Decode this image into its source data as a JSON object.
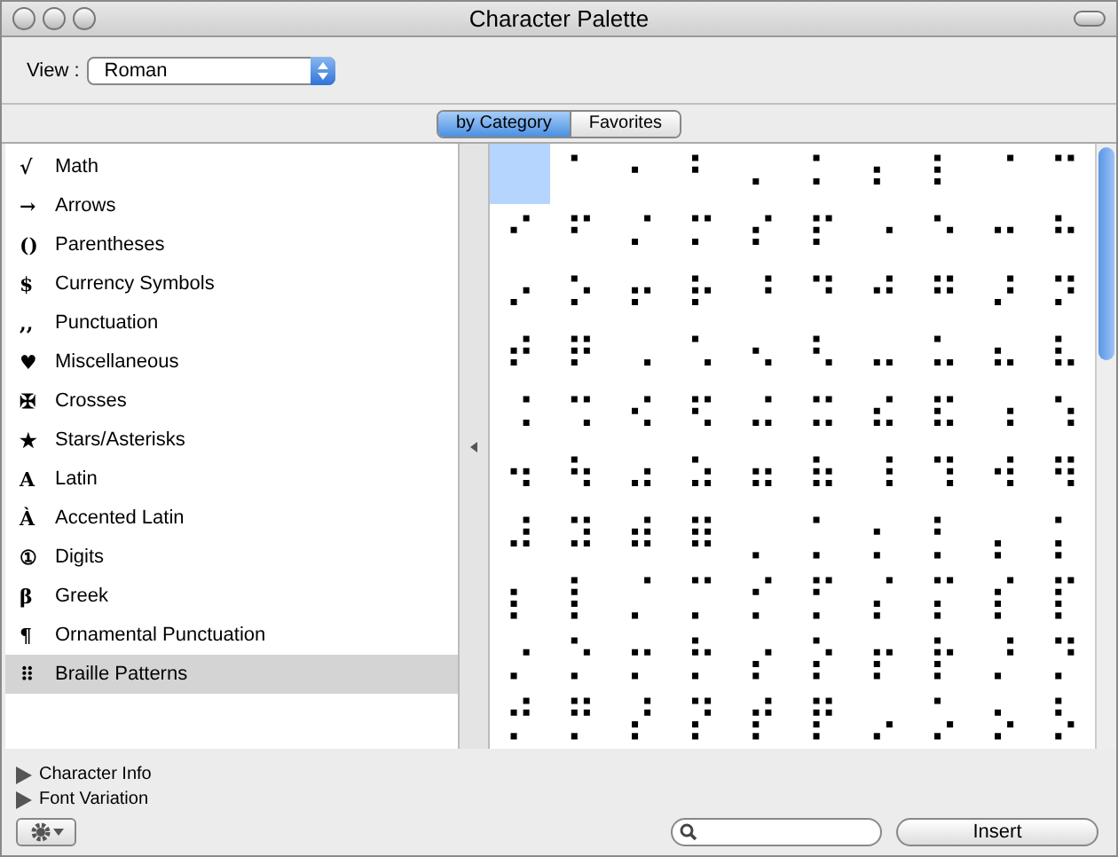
{
  "window": {
    "title": "Character Palette"
  },
  "view": {
    "label": "View :",
    "value": "Roman"
  },
  "tabs": [
    {
      "label": "by Category",
      "selected": true
    },
    {
      "label": "Favorites",
      "selected": false
    }
  ],
  "sidebar": {
    "items": [
      {
        "icon": "√",
        "label": "Math",
        "selected": false
      },
      {
        "icon": "→",
        "label": "Arrows",
        "selected": false
      },
      {
        "icon": "()",
        "label": "Parentheses",
        "selected": false
      },
      {
        "icon": "$",
        "label": "Currency Symbols",
        "selected": false
      },
      {
        "icon": ",,",
        "label": "Punctuation",
        "selected": false
      },
      {
        "icon": "♥",
        "label": "Miscellaneous",
        "selected": false
      },
      {
        "icon": "✠",
        "label": "Crosses",
        "selected": false
      },
      {
        "icon": "★",
        "label": "Stars/Asterisks",
        "selected": false
      },
      {
        "icon": "A",
        "label": "Latin",
        "selected": false
      },
      {
        "icon": "À",
        "label": "Accented Latin",
        "selected": false
      },
      {
        "icon": "①",
        "label": "Digits",
        "selected": false
      },
      {
        "icon": "β",
        "label": "Greek",
        "selected": false
      },
      {
        "icon": "¶",
        "label": "Ornamental Punctuation",
        "selected": false
      },
      {
        "icon": "⠿",
        "label": "Braille Patterns",
        "selected": true
      }
    ]
  },
  "grid": {
    "cells": [
      {
        "selected": true
      },
      {
        "char": "⠁",
        "selected": false
      },
      {
        "char": "⠂",
        "selected": false
      },
      {
        "char": "⠃",
        "selected": false
      },
      {
        "char": "⠄",
        "selected": false
      },
      {
        "char": "⠅",
        "selected": false
      },
      {
        "char": "⠆",
        "selected": false
      },
      {
        "char": "⠇",
        "selected": false
      },
      {
        "char": "⠈",
        "selected": false
      },
      {
        "char": "⠉",
        "selected": false
      },
      {
        "char": "⠊",
        "selected": false
      },
      {
        "char": "⠋",
        "selected": false
      },
      {
        "char": "⠌",
        "selected": false
      },
      {
        "char": "⠍",
        "selected": false
      },
      {
        "char": "⠎",
        "selected": false
      },
      {
        "char": "⠏",
        "selected": false
      },
      {
        "char": "⠐",
        "selected": false
      },
      {
        "char": "⠑",
        "selected": false
      },
      {
        "char": "⠒",
        "selected": false
      },
      {
        "char": "⠓",
        "selected": false
      },
      {
        "char": "⠔",
        "selected": false
      },
      {
        "char": "⠕",
        "selected": false
      },
      {
        "char": "⠖",
        "selected": false
      },
      {
        "char": "⠗",
        "selected": false
      },
      {
        "char": "⠘",
        "selected": false
      },
      {
        "char": "⠙",
        "selected": false
      },
      {
        "char": "⠚",
        "selected": false
      },
      {
        "char": "⠛",
        "selected": false
      },
      {
        "char": "⠜",
        "selected": false
      },
      {
        "char": "⠝",
        "selected": false
      },
      {
        "char": "⠞",
        "selected": false
      },
      {
        "char": "⠟",
        "selected": false
      },
      {
        "char": "⠠",
        "selected": false
      },
      {
        "char": "⠡",
        "selected": false
      },
      {
        "char": "⠢",
        "selected": false
      },
      {
        "char": "⠣",
        "selected": false
      },
      {
        "char": "⠤",
        "selected": false
      },
      {
        "char": "⠥",
        "selected": false
      },
      {
        "char": "⠦",
        "selected": false
      },
      {
        "char": "⠧",
        "selected": false
      },
      {
        "char": "⠨",
        "selected": false
      },
      {
        "char": "⠩",
        "selected": false
      },
      {
        "char": "⠪",
        "selected": false
      },
      {
        "char": "⠫",
        "selected": false
      },
      {
        "char": "⠬",
        "selected": false
      },
      {
        "char": "⠭",
        "selected": false
      },
      {
        "char": "⠮",
        "selected": false
      },
      {
        "char": "⠯",
        "selected": false
      },
      {
        "char": "⠰",
        "selected": false
      },
      {
        "char": "⠱",
        "selected": false
      },
      {
        "char": "⠲",
        "selected": false
      },
      {
        "char": "⠳",
        "selected": false
      },
      {
        "char": "⠴",
        "selected": false
      },
      {
        "char": "⠵",
        "selected": false
      },
      {
        "char": "⠶",
        "selected": false
      },
      {
        "char": "⠷",
        "selected": false
      },
      {
        "char": "⠸",
        "selected": false
      },
      {
        "char": "⠹",
        "selected": false
      },
      {
        "char": "⠺",
        "selected": false
      },
      {
        "char": "⠻",
        "selected": false
      },
      {
        "char": "⠼",
        "selected": false
      },
      {
        "char": "⠽",
        "selected": false
      },
      {
        "char": "⠾",
        "selected": false
      },
      {
        "char": "⠿",
        "selected": false
      },
      {
        "char": "⡀",
        "selected": false
      },
      {
        "char": "⡁",
        "selected": false
      },
      {
        "char": "⡂",
        "selected": false
      },
      {
        "char": "⡃",
        "selected": false
      },
      {
        "char": "⡄",
        "selected": false
      },
      {
        "char": "⡅",
        "selected": false
      },
      {
        "char": "⡆",
        "selected": false
      },
      {
        "char": "⡇",
        "selected": false
      },
      {
        "char": "⡈",
        "selected": false
      },
      {
        "char": "⡉",
        "selected": false
      },
      {
        "char": "⡊",
        "selected": false
      },
      {
        "char": "⡋",
        "selected": false
      },
      {
        "char": "⡌",
        "selected": false
      },
      {
        "char": "⡍",
        "selected": false
      },
      {
        "char": "⡎",
        "selected": false
      },
      {
        "char": "⡏",
        "selected": false
      },
      {
        "char": "⡐",
        "selected": false
      },
      {
        "char": "⡑",
        "selected": false
      },
      {
        "char": "⡒",
        "selected": false
      },
      {
        "char": "⡓",
        "selected": false
      },
      {
        "char": "⡔",
        "selected": false
      },
      {
        "char": "⡕",
        "selected": false
      },
      {
        "char": "⡖",
        "selected": false
      },
      {
        "char": "⡗",
        "selected": false
      },
      {
        "char": "⡘",
        "selected": false
      },
      {
        "char": "⡙",
        "selected": false
      },
      {
        "char": "⡚",
        "selected": false
      },
      {
        "char": "⡛",
        "selected": false
      },
      {
        "char": "⡜",
        "selected": false
      },
      {
        "char": "⡝",
        "selected": false
      },
      {
        "char": "⡞",
        "selected": false
      },
      {
        "char": "⡟",
        "selected": false
      },
      {
        "char": "⡠",
        "selected": false
      },
      {
        "char": "⡡",
        "selected": false
      },
      {
        "char": "⡢",
        "selected": false
      },
      {
        "char": "⡣",
        "selected": false
      }
    ]
  },
  "disclosures": [
    {
      "label": "Character Info",
      "expanded": false
    },
    {
      "label": "Font Variation",
      "expanded": false
    }
  ],
  "insert_button": "Insert"
}
